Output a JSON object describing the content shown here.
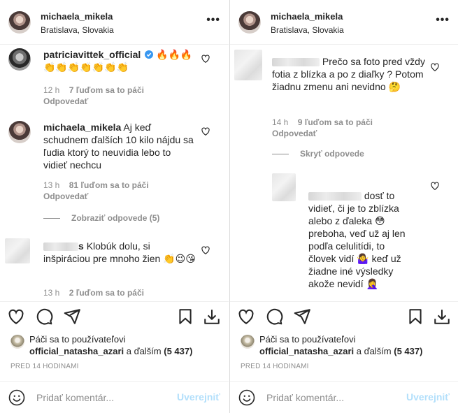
{
  "left": {
    "header": {
      "username": "michaela_mikela",
      "location": "Bratislava, Slovakia",
      "more": "•••"
    },
    "comments": [
      {
        "user": "patriciavittek_official",
        "verified": true,
        "text_emoji_row1": "🔥🔥🔥",
        "text_emoji_row2": "👏👏👏👏👏👏👏",
        "time": "12 h",
        "likes": "7 ľuďom sa to páči",
        "reply": "Odpovedať"
      },
      {
        "user": "michaela_mikela",
        "text": "Aj keď schudnem ďalších 10 kilo nájdu sa ľudia ktorý to neuvidia lebo to vidieť nechcu",
        "time": "13 h",
        "likes": "81 ľuďom sa to páči",
        "reply": "Odpovedať",
        "view_replies": "Zobraziť odpovede (5)"
      },
      {
        "user_suffix": "s",
        "text": "Klobúk dolu, si inšpiráciou pre mnoho žien",
        "emoji": "👏😉😘",
        "time": "13 h",
        "likes": "2 ľuďom sa to páči"
      }
    ],
    "likes": {
      "prefix": "Páči sa to používateľovi",
      "user": "official_natasha_azari",
      "middle": " a ďalším ",
      "count": "(5 437)"
    },
    "timeago": "PRED 14 HODINAMI",
    "comment_box": {
      "placeholder": "Pridať komentár...",
      "post": "Uverejniť"
    }
  },
  "right": {
    "header": {
      "username": "michaela_mikela",
      "location": "Bratislava, Slovakia",
      "more": "•••"
    },
    "comments": [
      {
        "text": "Prečo sa foto pred vždy fotia z blízka a po z diaľky ? Potom žiadnu zmenu ani nevidno",
        "emoji": "🤔",
        "time": "14 h",
        "likes": "9 ľuďom sa to páči",
        "reply": "Odpovedať",
        "hide_replies": "Skryť odpovede"
      },
      {
        "text": "dosť to vidieť, či je to zblízka alebo z ďaleka",
        "emoji1": "😳",
        "text2": "preboha, veď už aj len podľa celulitídi, to človek vidí",
        "emoji2": "🤷‍♀️",
        "text3": "keď už žiadne iné výsledky akože nevidí",
        "emoji3": "🤦‍♀️"
      }
    ],
    "likes": {
      "prefix": "Páči sa to používateľovi",
      "user": "official_natasha_azari",
      "middle": " a ďalším ",
      "count": "(5 437)"
    },
    "timeago": "PRED 14 HODINAMI",
    "comment_box": {
      "placeholder": "Pridať komentár...",
      "post": "Uverejniť"
    }
  },
  "icons": {
    "like": "heart-icon",
    "comment": "comment-icon",
    "share": "paper-plane-icon",
    "save": "bookmark-icon",
    "download": "download-icon",
    "emoji": "smiley-icon"
  },
  "colors": {
    "text": "#262626",
    "secondary": "#8e8e8e",
    "verified": "#3897f0",
    "post_button": "#b2dffb",
    "border": "#dbdbdb"
  }
}
